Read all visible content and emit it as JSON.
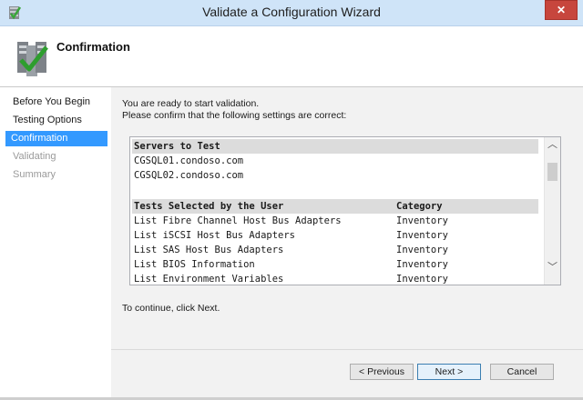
{
  "window": {
    "title": "Validate a Configuration Wizard",
    "close_label": "✕"
  },
  "header": {
    "title": "Confirmation",
    "icon": "server-checkmark-icon"
  },
  "nav": {
    "items": [
      {
        "label": "Before You Begin",
        "state": "normal"
      },
      {
        "label": "Testing Options",
        "state": "normal"
      },
      {
        "label": "Confirmation",
        "state": "active"
      },
      {
        "label": "Validating",
        "state": "disabled"
      },
      {
        "label": "Summary",
        "state": "disabled"
      }
    ]
  },
  "main": {
    "intro_line1": "You are ready to start validation.",
    "intro_line2": "Please confirm that the following settings are correct:",
    "servers_header": "Servers to Test",
    "servers": [
      "CGSQL01.condoso.com",
      "CGSQL02.condoso.com"
    ],
    "tests_header": "Tests Selected by the User",
    "category_header": "Category",
    "tests": [
      {
        "name": "List Fibre Channel Host Bus Adapters",
        "category": "Inventory"
      },
      {
        "name": "List iSCSI Host Bus Adapters",
        "category": "Inventory"
      },
      {
        "name": "List SAS Host Bus Adapters",
        "category": "Inventory"
      },
      {
        "name": "List BIOS Information",
        "category": "Inventory"
      },
      {
        "name": "List Environment Variables",
        "category": "Inventory"
      }
    ],
    "continue_text": "To continue, click Next."
  },
  "buttons": {
    "previous": "< Previous",
    "next": "Next >",
    "cancel": "Cancel"
  },
  "colors": {
    "selection": "#3399ff",
    "titlebar": "#cfe4f8",
    "close": "#c7463d"
  }
}
